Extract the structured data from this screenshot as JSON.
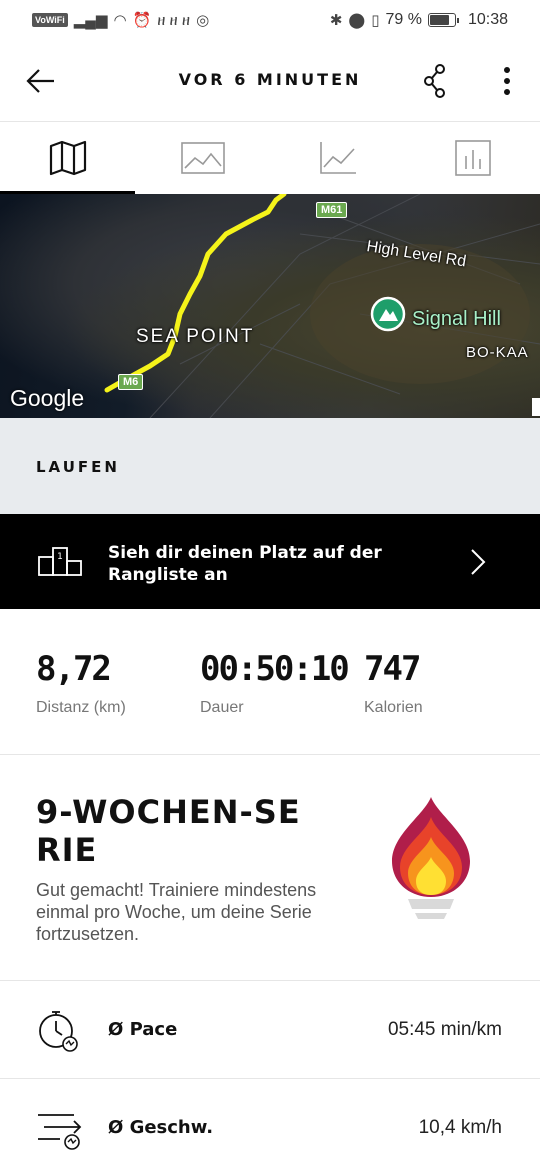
{
  "status_bar": {
    "left_badge": "VoWiFi",
    "battery_percent": "79 %",
    "battery_level": 0.79,
    "time": "10:38"
  },
  "header": {
    "title": "VOR 6 MINUTEN"
  },
  "tabs": [
    {
      "name": "map",
      "icon": "map-icon",
      "active": true
    },
    {
      "name": "photos",
      "icon": "image-icon",
      "active": false
    },
    {
      "name": "graph",
      "icon": "line-chart-icon",
      "active": false
    },
    {
      "name": "stats",
      "icon": "bar-chart-icon",
      "active": false
    }
  ],
  "map": {
    "labels": {
      "sea_point": "SEA POINT",
      "high_level_rd": "High Level Rd",
      "signal_hill": "Signal Hill",
      "bo_kaap": "BO-KAA",
      "road_m61": "M61",
      "road_m6": "M6",
      "attribution": "Google"
    },
    "route_color": "#f5f31a"
  },
  "activity": {
    "type_label": "LAUFEN"
  },
  "leaderboard": {
    "text": "Sieh dir deinen Platz auf der Rangliste an"
  },
  "stats": {
    "distance": {
      "value": "8,72",
      "label": "Distanz (km)"
    },
    "duration": {
      "value": "00:50:10",
      "label": "Dauer"
    },
    "calories": {
      "value": "747",
      "label": "Kalorien"
    }
  },
  "streak": {
    "title": "9-WOCHEN-SERIE",
    "title_line1": "9-WOCHEN-SE",
    "title_line2": "RIE",
    "description": "Gut gemacht! Trainiere mindestens einmal pro Woche, um deine Serie fortzusetzen."
  },
  "metrics": [
    {
      "label": "Ø Pace",
      "value": "05:45 min/km",
      "icon": "stopwatch-icon"
    },
    {
      "label": "Ø Geschw.",
      "value": "10,4 km/h",
      "icon": "speed-icon"
    }
  ],
  "colors": {
    "accent_black": "#000000",
    "band_gray": "#e8ebee",
    "flame_outer": "#b01e4a",
    "flame_mid": "#e8432a",
    "flame_inner": "#f7941d",
    "flame_core": "#ffe033"
  }
}
